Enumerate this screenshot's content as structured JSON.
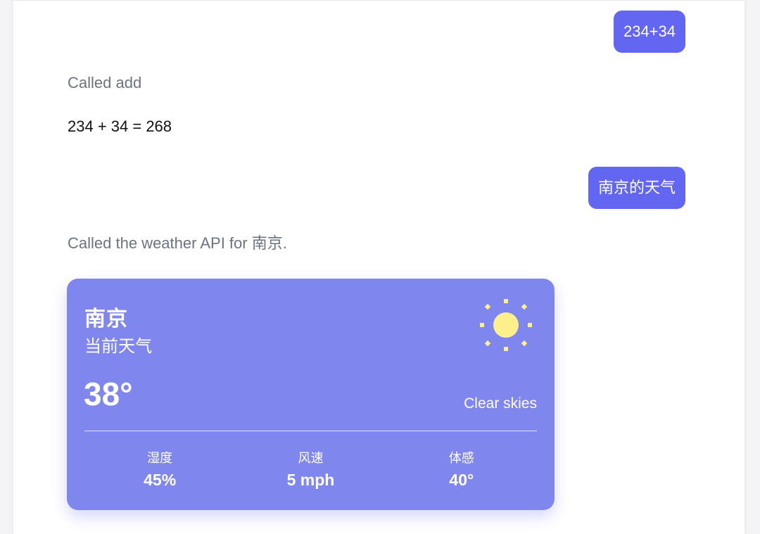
{
  "messages": {
    "user_1": "234+34",
    "assistant_note_1": "Called add",
    "assistant_text_1": "234 + 34 = 268",
    "user_2": "南京的天气",
    "assistant_note_2": "Called the weather API for 南京."
  },
  "weather_card": {
    "city": "南京",
    "subtitle": "当前天气",
    "temperature": "38°",
    "condition": "Clear skies",
    "condition_icon": "sun-icon",
    "stats": [
      {
        "label": "湿度",
        "value": "45%"
      },
      {
        "label": "风速",
        "value": "5 mph"
      },
      {
        "label": "体感",
        "value": "40°"
      }
    ],
    "colors": {
      "card_background": "#7f87ee",
      "sun": "#fdf08c",
      "user_bubble": "#6366f1"
    }
  }
}
